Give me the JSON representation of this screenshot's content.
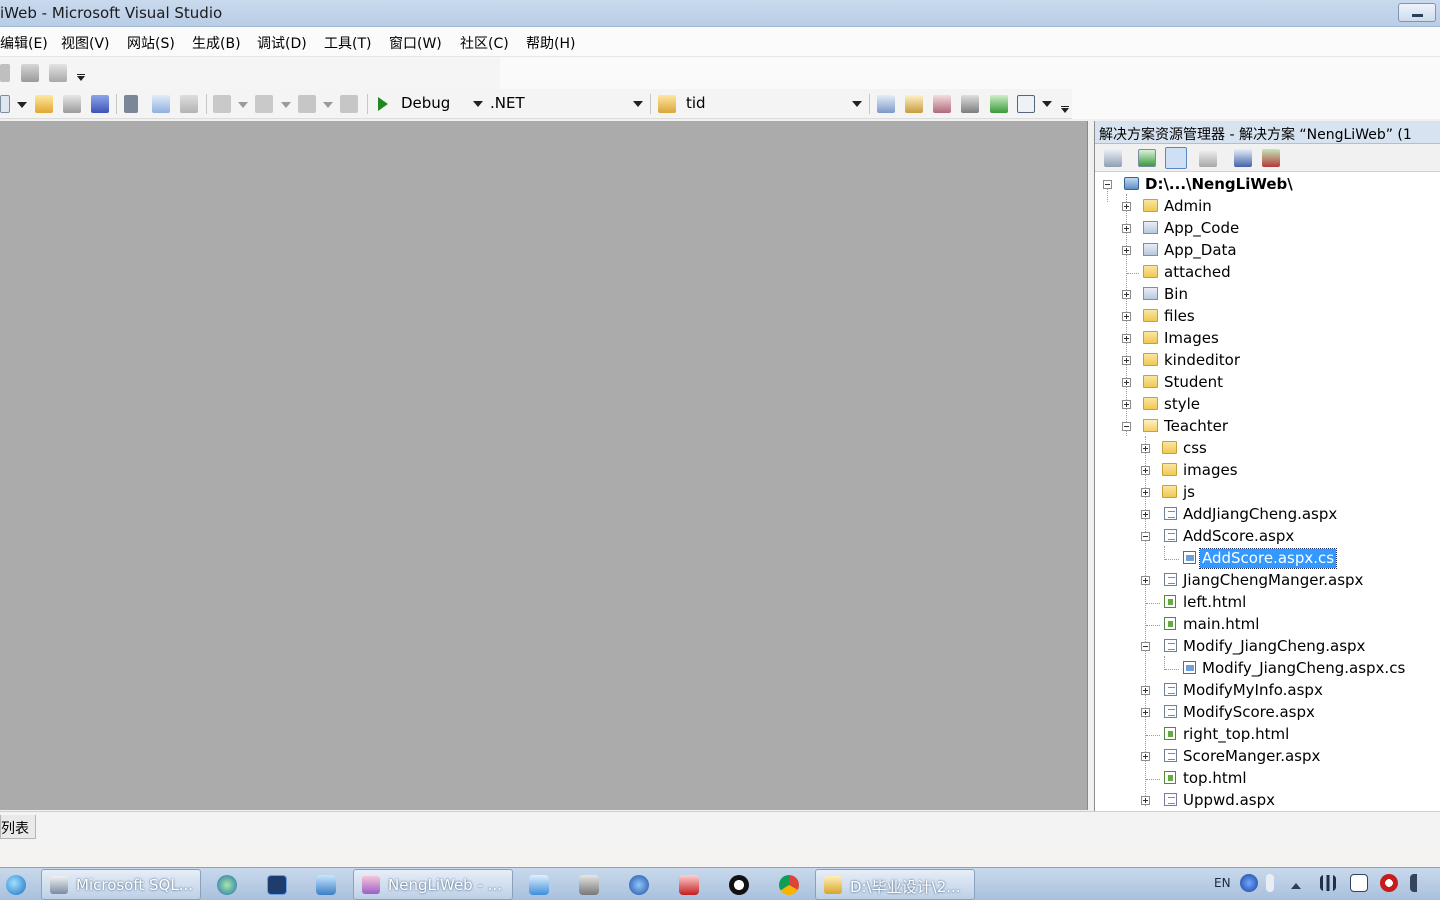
{
  "window": {
    "title": "iWeb - Microsoft Visual Studio"
  },
  "menu": [
    "编辑(E)",
    "视图(V)",
    "网站(S)",
    "生成(B)",
    "调试(D)",
    "工具(T)",
    "窗口(W)",
    "社区(C)",
    "帮助(H)"
  ],
  "toolbar": {
    "config": "Debug",
    "platform": ".NET",
    "find": "tid"
  },
  "solution_explorer": {
    "title": "解决方案资源管理器 - 解决方案 “NengLiWeb” (1",
    "tree": [
      {
        "label": "D:\\...\\NengLiWeb\\",
        "icon": "project-icon",
        "state": "expanded"
      },
      {
        "label": "Admin",
        "icon": "folder-icon",
        "state": "collapsed"
      },
      {
        "label": "App_Code",
        "icon": "system-folder-icon",
        "state": "collapsed"
      },
      {
        "label": "App_Data",
        "icon": "system-folder-icon",
        "state": "collapsed"
      },
      {
        "label": "attached",
        "icon": "folder-icon",
        "state": "leaf"
      },
      {
        "label": "Bin",
        "icon": "system-folder-icon",
        "state": "collapsed"
      },
      {
        "label": "files",
        "icon": "folder-icon",
        "state": "collapsed"
      },
      {
        "label": "Images",
        "icon": "folder-icon",
        "state": "collapsed"
      },
      {
        "label": "kindeditor",
        "icon": "folder-icon",
        "state": "collapsed"
      },
      {
        "label": "Student",
        "icon": "folder-icon",
        "state": "collapsed"
      },
      {
        "label": "style",
        "icon": "folder-icon",
        "state": "collapsed"
      },
      {
        "label": "Teachter",
        "icon": "open-folder-icon",
        "state": "expanded"
      },
      {
        "label": "css",
        "icon": "folder-icon",
        "state": "collapsed"
      },
      {
        "label": "images",
        "icon": "folder-icon",
        "state": "collapsed"
      },
      {
        "label": "js",
        "icon": "folder-icon",
        "state": "collapsed"
      },
      {
        "label": "AddJiangCheng.aspx",
        "icon": "aspx-page-icon",
        "state": "collapsed"
      },
      {
        "label": "AddScore.aspx",
        "icon": "aspx-page-icon",
        "state": "expanded"
      },
      {
        "label": "AddScore.aspx.cs",
        "icon": "cs-file-icon",
        "state": "selected"
      },
      {
        "label": "JiangChengManger.aspx",
        "icon": "aspx-page-icon",
        "state": "collapsed"
      },
      {
        "label": "left.html",
        "icon": "html-file-icon",
        "state": "leaf"
      },
      {
        "label": "main.html",
        "icon": "html-file-icon",
        "state": "leaf"
      },
      {
        "label": "Modify_JiangCheng.aspx",
        "icon": "aspx-page-icon",
        "state": "expanded"
      },
      {
        "label": "Modify_JiangCheng.aspx.cs",
        "icon": "cs-file-icon",
        "state": "leaf"
      },
      {
        "label": "ModifyMyInfo.aspx",
        "icon": "aspx-page-icon",
        "state": "collapsed"
      },
      {
        "label": "ModifyScore.aspx",
        "icon": "aspx-page-icon",
        "state": "collapsed"
      },
      {
        "label": "right_top.html",
        "icon": "html-file-icon",
        "state": "leaf"
      },
      {
        "label": "ScoreManger.aspx",
        "icon": "aspx-page-icon",
        "state": "collapsed"
      },
      {
        "label": "top.html",
        "icon": "html-file-icon",
        "state": "leaf"
      },
      {
        "label": "Uppwd.aspx",
        "icon": "aspx-page-icon",
        "state": "collapsed"
      }
    ]
  },
  "bottom_tab": "错误列表",
  "taskbar": {
    "buttons": [
      "Microsoft SQL...",
      "NengLiWeb - ...",
      "D:\\毕业设计\\2..."
    ],
    "tray_lang": "EN"
  }
}
